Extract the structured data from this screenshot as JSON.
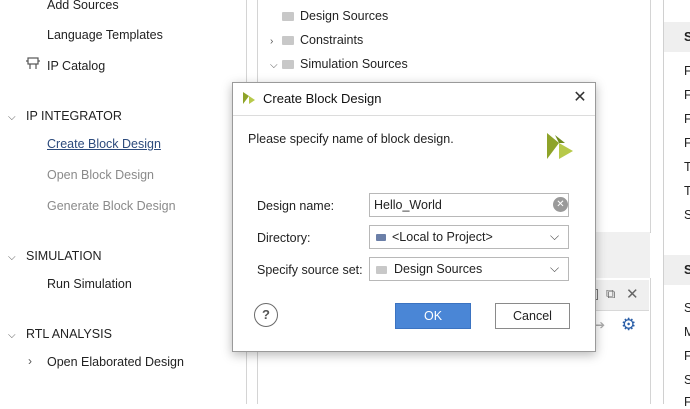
{
  "flow_navigator": {
    "add_sources": "Add Sources",
    "language_templates": "Language Templates",
    "ip_catalog": "IP Catalog",
    "ip_integrator": "IP INTEGRATOR",
    "create_block_design": "Create Block Design",
    "open_block_design": "Open Block Design",
    "generate_block_design": "Generate Block Design",
    "simulation": "SIMULATION",
    "run_simulation": "Run Simulation",
    "rtl_analysis": "RTL ANALYSIS",
    "open_elaborated_design": "Open Elaborated Design"
  },
  "sources": {
    "design_sources": "Design Sources",
    "constraints": "Constraints",
    "simulation_sources": "Simulation Sources"
  },
  "right_panel": {
    "hdr1": "S",
    "hdr2": "S",
    "rows": [
      "F",
      "F",
      "F",
      "F",
      "T",
      "T",
      "S"
    ],
    "rows2": [
      "S",
      "M",
      "F",
      "S",
      "F"
    ]
  },
  "dialog": {
    "title": "Create Block Design",
    "prompt": "Please specify name of block design.",
    "design_name_label": "Design name:",
    "design_name_value": "Hello_World",
    "directory_label": "Directory:",
    "directory_value": "<Local to Project>",
    "source_set_label": "Specify source set:",
    "source_set_value": "Design Sources",
    "ok_label": "OK",
    "cancel_label": "Cancel",
    "help_label": "?"
  },
  "colors": {
    "primary_button": "#4a86d6",
    "xilinx_logo": "#8ea329",
    "link": "#2c4a7c"
  }
}
